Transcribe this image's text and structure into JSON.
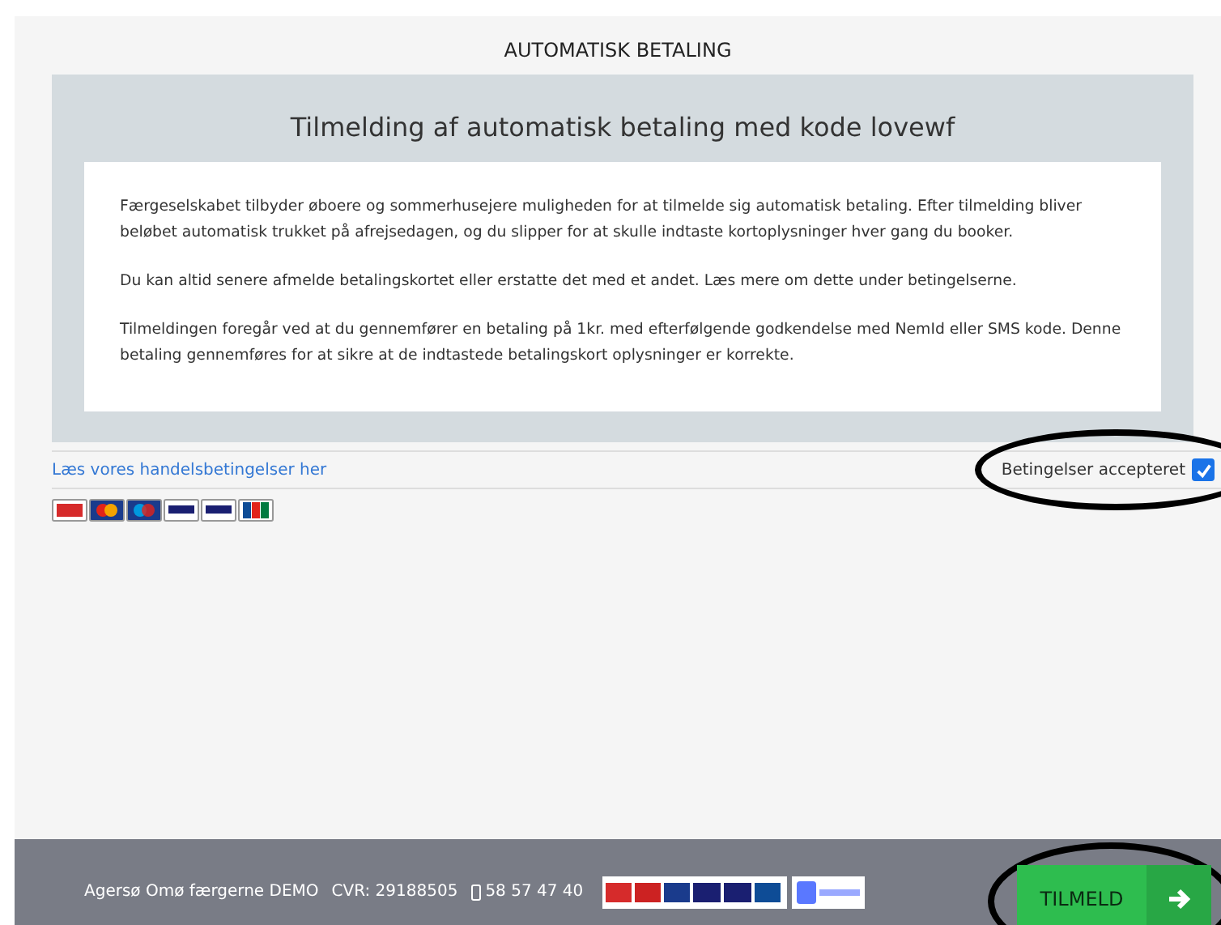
{
  "header": {
    "title": "AUTOMATISK BETALING"
  },
  "info": {
    "title": "Tilmelding af automatisk betaling med kode lovewf",
    "paragraphs": [
      "Færgeselskabet tilbyder øboere og sommerhusejere muligheden for at tilmelde sig automatisk betaling. Efter tilmelding bliver beløbet automatisk trukket på afrejsedagen, og du slipper for at skulle indtaste kortoplysninger hver gang du booker.",
      "Du kan altid senere afmelde betalingskortet eller erstatte det med et andet. Læs mere om dette under betingelserne.",
      "Tilmeldingen foregår ved at du gennemfører en betaling på 1kr. med efterfølgende godkendelse med NemId eller SMS kode. Denne betaling gennemføres for at sikre at de indtastede betalingskort oplysninger er korrekte."
    ]
  },
  "terms": {
    "link": "Læs vores handelsbetingelser her",
    "checkbox_label": "Betingelser accepteret",
    "checked": true
  },
  "footer": {
    "company": "Agersø Omø færgerne DEMO",
    "cvr": "CVR: 29188505",
    "phone": "58 57 47 40",
    "button": "TILMELD"
  }
}
